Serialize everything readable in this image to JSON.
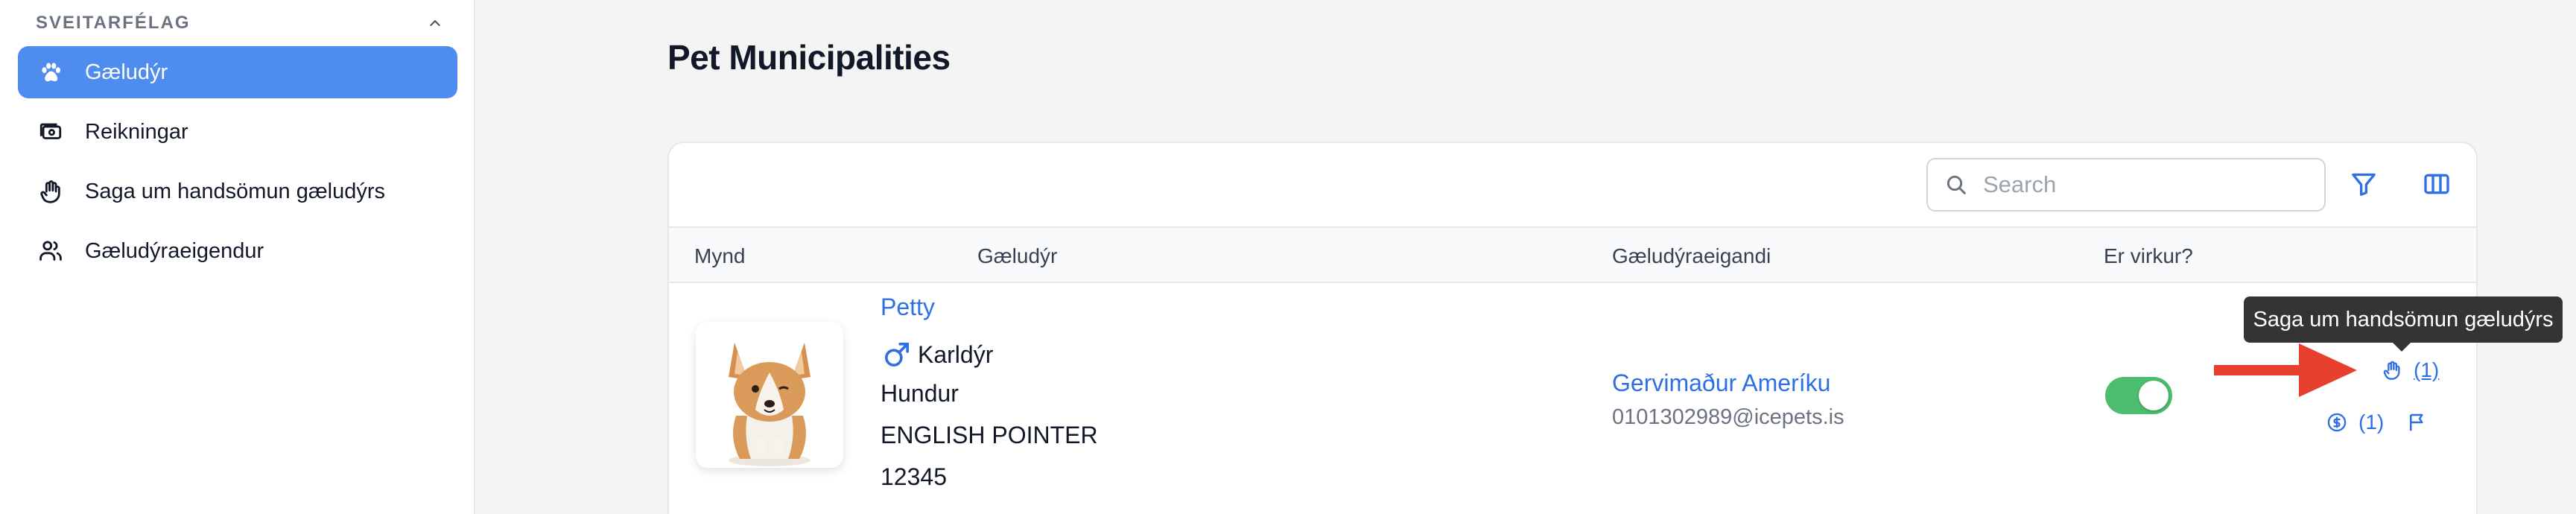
{
  "sidebar": {
    "group_title": "SVEITARFÉLAG",
    "items": [
      {
        "label": "Gæludýr",
        "icon": "paw-icon",
        "active": true
      },
      {
        "label": "Reikningar",
        "icon": "invoice-icon",
        "active": false
      },
      {
        "label": "Saga um handsömun gæludýrs",
        "icon": "hand-icon",
        "active": false
      },
      {
        "label": "Gæludýraeigendur",
        "icon": "users-icon",
        "active": false
      }
    ]
  },
  "page": {
    "title": "Pet Municipalities"
  },
  "toolbar": {
    "search_placeholder": "Search"
  },
  "table": {
    "columns": [
      "Mynd",
      "Gæludýr",
      "Gæludýraeigandi",
      "Er virkur?"
    ],
    "rows": [
      {
        "pet_name": "Petty",
        "gender": "Karldýr",
        "species": "Hundur",
        "breed": "ENGLISH POINTER",
        "chip": "12345",
        "owner_name": "Gervimaður Ameríku",
        "owner_email": "0101302989@icepets.is",
        "active": true,
        "capture_count": "(1)",
        "invoice_count": "(1)"
      }
    ]
  },
  "tooltip": {
    "text": "Saga um handsömun gæludýrs"
  },
  "colors": {
    "accent": "#4f8cf0",
    "link": "#2f6fe4",
    "toggle_on": "#4cbd6e",
    "arrow": "#e8402f"
  }
}
